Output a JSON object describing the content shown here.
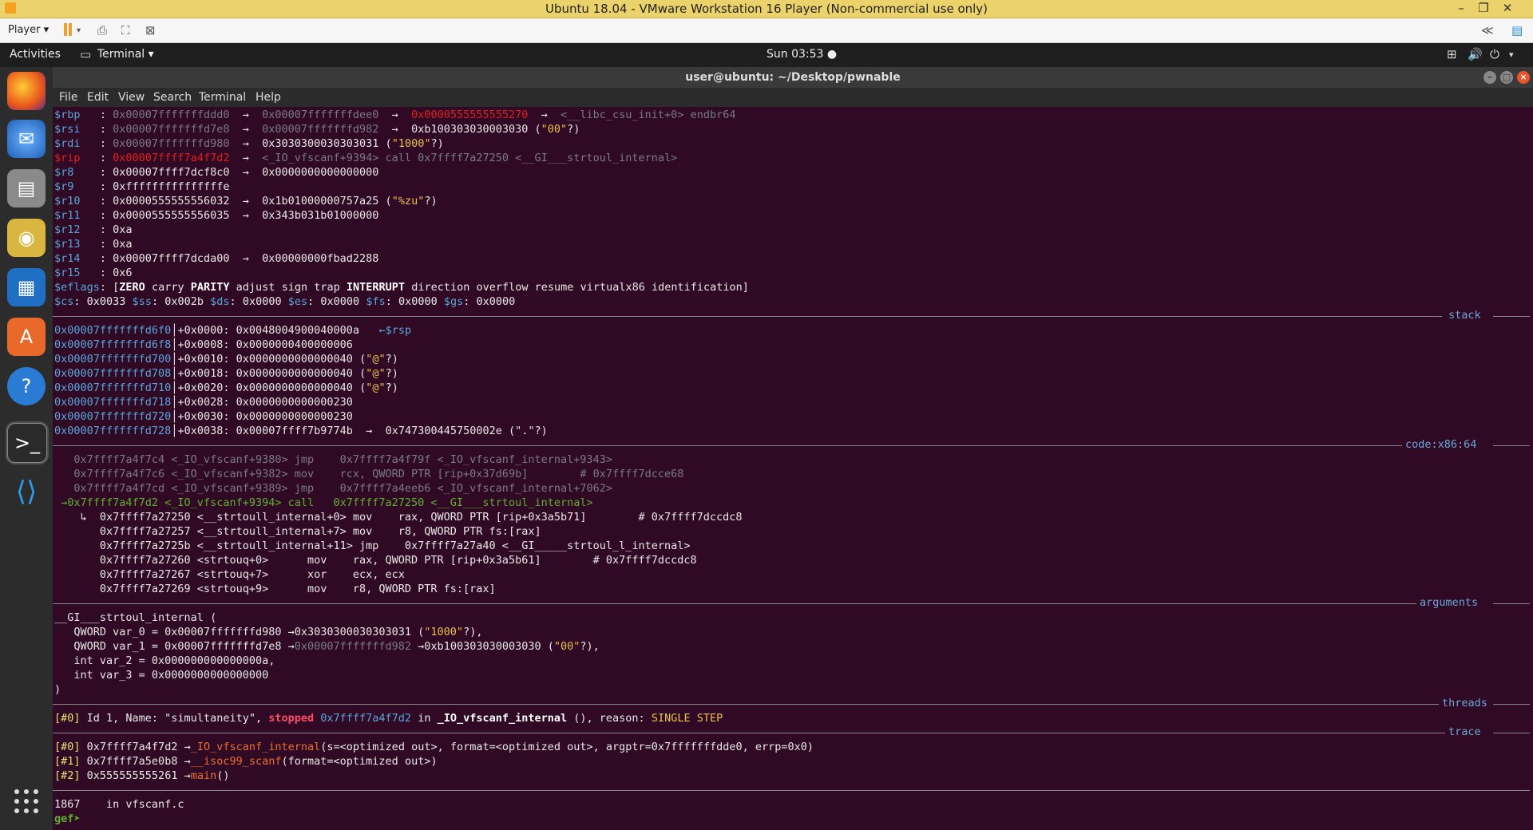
{
  "vmware": {
    "title": "Ubuntu 18.04 - VMware Workstation 16 Player (Non-commercial use only)",
    "player_menu": "Player ▾"
  },
  "topbar": {
    "activities": "Activities",
    "app_menu": "Terminal ▾",
    "clock": "Sun 03:53 ●"
  },
  "terminal": {
    "title": "user@ubuntu: ~/Desktop/pwnable",
    "menu": [
      "File",
      "Edit",
      "View",
      "Search",
      "Terminal",
      "Help"
    ]
  },
  "registers": {
    "rbp": {
      "name": "$rbp",
      "value": "0x00007fffffffddd0",
      "arrow1": "0x00007fffffffdee0",
      "arrow2": "0x0000555555555270",
      "sym": "<__libc_csu_init+0> endbr64"
    },
    "rsi": {
      "name": "$rsi",
      "value": "0x00007fffffffd7e8",
      "arrow1": "0x00007fffffffd982",
      "arrow2": "0xb100303030003030",
      "str": "\"00\"",
      "q": "?)"
    },
    "rdi": {
      "name": "$rdi",
      "value": "0x00007fffffffd980",
      "arrow1": "0x3030300030303031",
      "str": "\"1000\"",
      "q": "?)"
    },
    "rip": {
      "name": "$rip",
      "value": "0x00007ffff7a4f7d2",
      "arrow1": "<_IO_vfscanf+9394> call 0x7ffff7a27250 <__GI___strtoul_internal>"
    },
    "r8": {
      "name": "$r8",
      "value": "0x00007ffff7dcf8c0",
      "arrow1": "0x0000000000000000"
    },
    "r9": {
      "name": "$r9",
      "value": "0xfffffffffffffffe"
    },
    "r10": {
      "name": "$r10",
      "value": "0x0000555555556032",
      "arrow1": "0x1b01000000757a25",
      "str": "\"%zu\"",
      "q": "?)"
    },
    "r11": {
      "name": "$r11",
      "value": "0x0000555555556035",
      "arrow1": "0x343b031b01000000"
    },
    "r12": {
      "name": "$r12",
      "value": "0xa"
    },
    "r13": {
      "name": "$r13",
      "value": "0xa"
    },
    "r14": {
      "name": "$r14",
      "value": "0x00007ffff7dcda00",
      "arrow1": "0x00000000fbad2288"
    },
    "r15": {
      "name": "$r15",
      "value": "0x6"
    },
    "eflags": {
      "name": "$eflags",
      "flags": [
        "ZERO",
        "carry",
        "PARITY",
        "adjust",
        "sign",
        "trap",
        "INTERRUPT",
        "direction",
        "overflow",
        "resume",
        "virtualx86",
        "identification"
      ]
    },
    "segments": [
      {
        "name": "$cs",
        "value": "0x0033"
      },
      {
        "name": "$ss",
        "value": "0x002b"
      },
      {
        "name": "$ds",
        "value": "0x0000"
      },
      {
        "name": "$es",
        "value": "0x0000"
      },
      {
        "name": "$fs",
        "value": "0x0000"
      },
      {
        "name": "$gs",
        "value": "0x0000"
      }
    ]
  },
  "sections": {
    "stack": "stack",
    "code": "code:x86:64",
    "arguments": "arguments",
    "threads": "threads",
    "trace": "trace"
  },
  "stack": [
    {
      "addr": "0x00007fffffffd6f0",
      "off": "+0x0000:",
      "val": "0x0048004900040000a",
      "note": "←$rsp"
    },
    {
      "addr": "0x00007fffffffd6f8",
      "off": "+0x0008:",
      "val": "0x0000000400000006"
    },
    {
      "addr": "0x00007fffffffd700",
      "off": "+0x0010:",
      "val": "0x0000000000000040",
      "str": "\"@\""
    },
    {
      "addr": "0x00007fffffffd708",
      "off": "+0x0018:",
      "val": "0x0000000000000040",
      "str": "\"@\""
    },
    {
      "addr": "0x00007fffffffd710",
      "off": "+0x0020:",
      "val": "0x0000000000000040",
      "str": "\"@\""
    },
    {
      "addr": "0x00007fffffffd718",
      "off": "+0x0028:",
      "val": "0x0000000000000230"
    },
    {
      "addr": "0x00007fffffffd720",
      "off": "+0x0030:",
      "val": "0x0000000000000230"
    },
    {
      "addr": "0x00007fffffffd728",
      "off": "+0x0038:",
      "val": "0x00007ffff7b9774b",
      "arrow": "0x747300445750002e",
      "str": "\".\""
    }
  ],
  "code": [
    "   0x7ffff7a4f7c4 <_IO_vfscanf+9380> jmp    0x7ffff7a4f79f <_IO_vfscanf_internal+9343>",
    "   0x7ffff7a4f7c6 <_IO_vfscanf+9382> mov    rcx, QWORD PTR [rip+0x37d69b]        # 0x7ffff7dcce68",
    "   0x7ffff7a4f7cd <_IO_vfscanf+9389> jmp    0x7ffff7a4eeb6 <_IO_vfscanf_internal+7062>",
    " →0x7ffff7a4f7d2 <_IO_vfscanf+9394> call   0x7ffff7a27250 <__GI___strtoul_internal>",
    "    ↳  0x7ffff7a27250 <__strtoull_internal+0> mov    rax, QWORD PTR [rip+0x3a5b71]        # 0x7ffff7dccdc8",
    "       0x7ffff7a27257 <__strtoull_internal+7> mov    r8, QWORD PTR fs:[rax]",
    "       0x7ffff7a2725b <__strtoull_internal+11> jmp    0x7ffff7a27a40 <__GI_____strtoul_l_internal>",
    "       0x7ffff7a27260 <strtouq+0>      mov    rax, QWORD PTR [rip+0x3a5b61]        # 0x7ffff7dccdc8",
    "       0x7ffff7a27267 <strtouq+7>      xor    ecx, ecx",
    "       0x7ffff7a27269 <strtouq+9>      mov    r8, QWORD PTR fs:[rax]"
  ],
  "arguments": {
    "header": "__GI___strtoul_internal (",
    "var0": "   QWORD var_0 = 0x00007fffffffd980 →0x3030300030303031 (",
    "var0_str": "\"1000\"",
    "var1a": "   QWORD var_1 = 0x00007fffffffd7e8 →",
    "var1_dim": "0x00007fffffffd982",
    "var1b": " →0xb100303030003030 (",
    "var1_str": "\"00\"",
    "var2": "   int var_2 = 0x000000000000000a,",
    "var3": "   int var_3 = 0x0000000000000000",
    "close": ")"
  },
  "threads": {
    "id": "[#0]",
    "a": " Id 1, Name: \"simultaneity\", ",
    "state": "stopped",
    "addr": "0x7ffff7a4f7d2",
    "b": " in ",
    "func": "_IO_vfscanf_internal",
    "c": " (), reason: ",
    "reason": "SINGLE STEP"
  },
  "trace": [
    {
      "id": "[#0]",
      "addr": "0x7ffff7a4f7d2",
      "func": "_IO_vfscanf_internal",
      "args": "(s=<optimized out>, format=<optimized out>, argptr=0x7fffffffdde0, errp=0x0)"
    },
    {
      "id": "[#1]",
      "addr": "0x7ffff7a5e0b8",
      "func": "__isoc99_scanf",
      "args": "(format=<optimized out>)"
    },
    {
      "id": "[#2]",
      "addr": "0x555555555261",
      "func": "main",
      "args": "()"
    }
  ],
  "source_line": "1867    in vfscanf.c",
  "prompt": "gef➤ "
}
